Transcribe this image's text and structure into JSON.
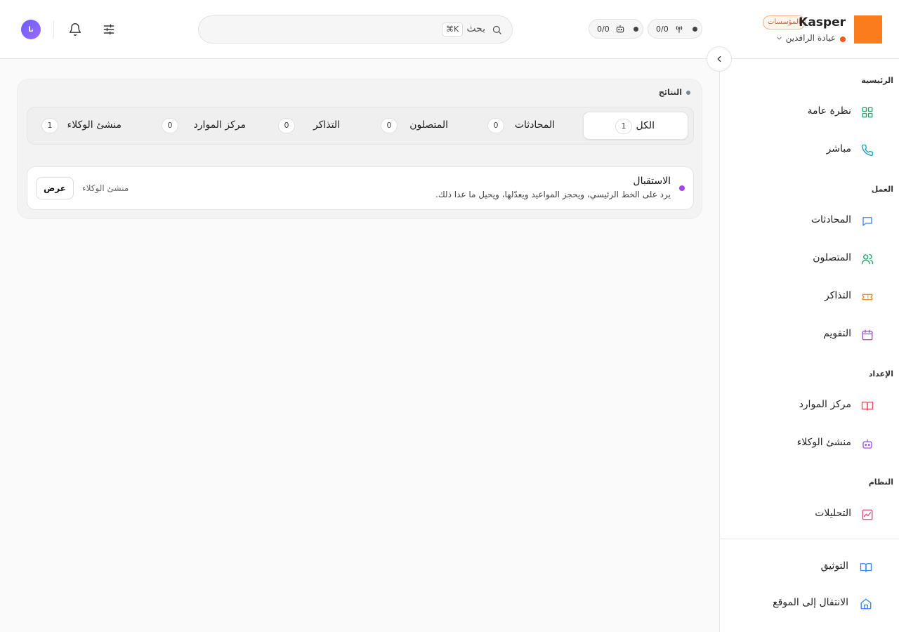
{
  "user": {
    "avatar_initials": "نا"
  },
  "search": {
    "label": "بحث",
    "shortcut": "⌘K"
  },
  "status": {
    "pill_agents": {
      "value": "0/0"
    },
    "pill_live": {
      "value": "0/0"
    }
  },
  "brand": {
    "name": "Kasper",
    "badge": "المؤسسات",
    "org_name": "عيادة الرافدين",
    "logo_color": "#fb7c1d"
  },
  "sidebar": {
    "sections": [
      {
        "title": "الرئيسية",
        "items": [
          {
            "label": "نظرة عامة",
            "icon": "grid-icon",
            "color": "#22a06b"
          },
          {
            "label": "مباشر",
            "icon": "phone-icon",
            "color": "#1f9bb8"
          }
        ]
      },
      {
        "title": "العمل",
        "items": [
          {
            "label": "المحادثات",
            "icon": "chat-icon",
            "color": "#3b82f6"
          },
          {
            "label": "المتصلون",
            "icon": "users-icon",
            "color": "#22a06b"
          },
          {
            "label": "التذاكر",
            "icon": "ticket-icon",
            "color": "#e08a1a"
          },
          {
            "label": "التقويم",
            "icon": "calendar-icon",
            "color": "#9b4fc2"
          }
        ]
      },
      {
        "title": "الإعداد",
        "items": [
          {
            "label": "مركز الموارد",
            "icon": "book-icon",
            "color": "#e5484d"
          },
          {
            "label": "منشئ الوكلاء",
            "icon": "robot-icon",
            "color": "#9b4fe6"
          }
        ]
      },
      {
        "title": "النظام",
        "items": [
          {
            "label": "التحليلات",
            "icon": "chart-icon",
            "color": "#e5487a"
          }
        ]
      }
    ],
    "footer": [
      {
        "label": "التوثيق",
        "icon": "docs-icon",
        "color": "#3b82f6"
      },
      {
        "label": "الانتقال إلى الموقع",
        "icon": "home-icon",
        "color": "#3b82f6"
      }
    ]
  },
  "results": {
    "title": "النتائج",
    "tabs": [
      {
        "label": "الكل",
        "count": "1"
      },
      {
        "label": "المحادثات",
        "count": "0"
      },
      {
        "label": "المتصلون",
        "count": "0"
      },
      {
        "label": "التذاكر",
        "count": "0"
      },
      {
        "label": "مركز الموارد",
        "count": "0"
      },
      {
        "label": "منشئ الوكلاء",
        "count": "1"
      }
    ],
    "items": [
      {
        "title": "الاستقبال",
        "description": "يرد على الخط الرئيسي، ويحجز المواعيد ويعدّلها، ويحيل ما عدا ذلك.",
        "type": "منشئ الوكلاء",
        "action": "عرض"
      }
    ]
  }
}
